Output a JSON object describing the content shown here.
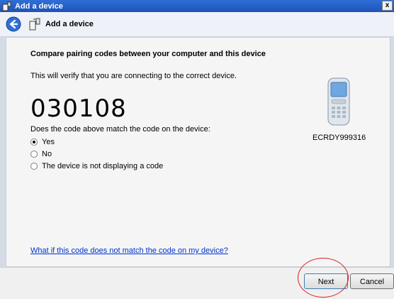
{
  "window": {
    "title": "Add a device",
    "close_label": "x"
  },
  "header": {
    "title": "Add a device"
  },
  "main": {
    "heading": "Compare pairing codes between your computer and this device",
    "subtext": "This will verify that you are connecting to the correct device.",
    "code": "030108",
    "question": "Does the code above match the code on the device:",
    "options": [
      {
        "label": "Yes",
        "selected": true
      },
      {
        "label": "No",
        "selected": false
      },
      {
        "label": "The device is not displaying a code",
        "selected": false
      }
    ],
    "device_name": "ECRDY999316",
    "help_link": "What if this code does not match the code on my device?"
  },
  "footer": {
    "next_label": "Next",
    "cancel_label": "Cancel"
  },
  "icons": [
    "add-device-icon",
    "back-arrow-icon",
    "phone-device-icon",
    "close-icon"
  ],
  "colors": {
    "titlebar": "#1f52b8",
    "link": "#0033cc",
    "annotation": "#d82020"
  }
}
